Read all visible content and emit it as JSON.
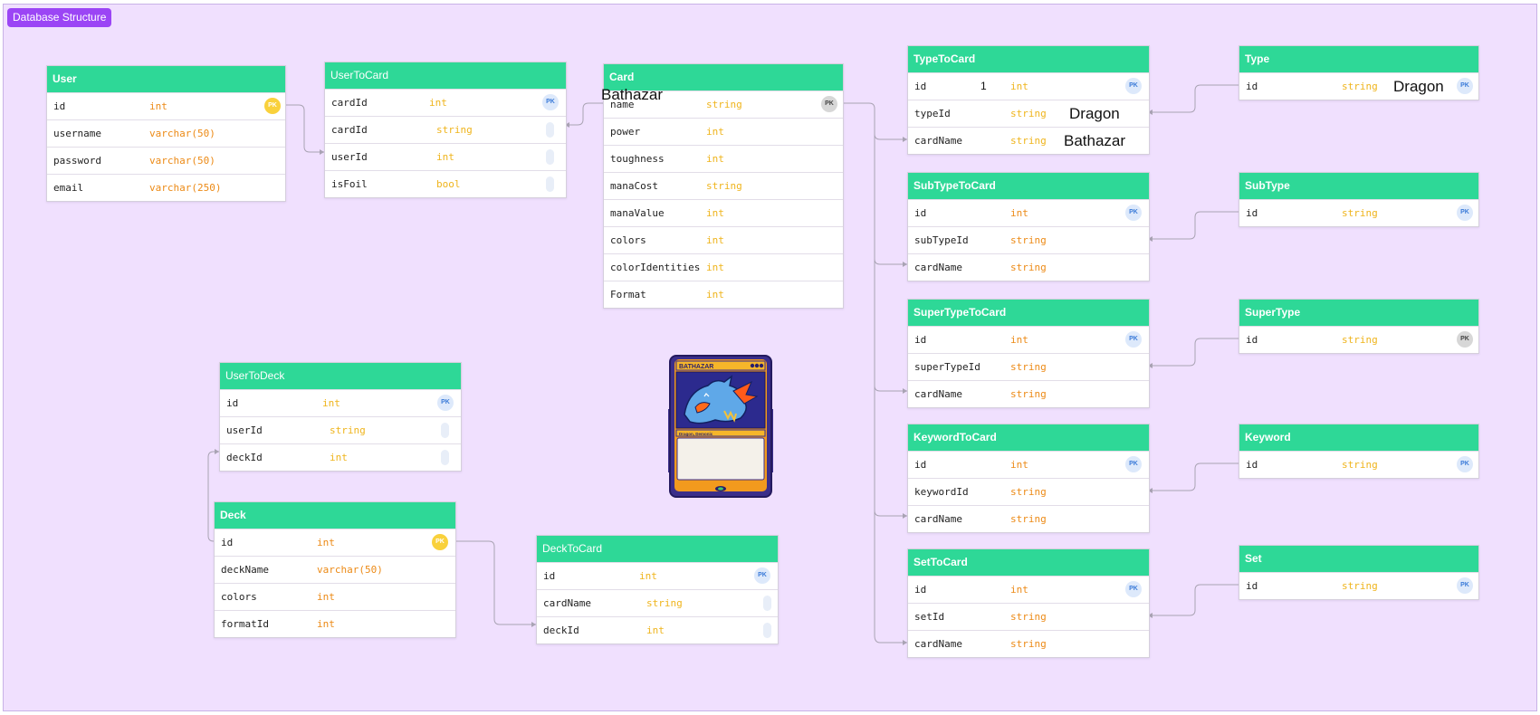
{
  "frame": {
    "label": "Database Structure"
  },
  "colors": {
    "background": "#f0e0fe",
    "header": "#2ed897",
    "frame_label": "#9b45f5",
    "type_orange": "#ec8a16",
    "type_yellow": "#efb41c",
    "pk_blue": "#dde9fb",
    "pk_gold": "#f9d13c"
  },
  "tables": {
    "user": {
      "title": "User",
      "rows": [
        {
          "field": "id",
          "type": "int",
          "badge": "PK"
        },
        {
          "field": "username",
          "type": "varchar(50)"
        },
        {
          "field": "password",
          "type": "varchar(50)"
        },
        {
          "field": "email",
          "type": "varchar(250)"
        }
      ]
    },
    "usertocard": {
      "title": "UserToCard",
      "rows": [
        {
          "field": "cardId",
          "type": "int",
          "badge": "PK"
        },
        {
          "field": "cardId",
          "type": "string"
        },
        {
          "field": "userId",
          "type": "int"
        },
        {
          "field": "isFoil",
          "type": "bool"
        }
      ]
    },
    "card": {
      "title": "Card",
      "overlay_text": "Bathazar",
      "rows": [
        {
          "field": "name",
          "type": "string",
          "badge": "PK"
        },
        {
          "field": "power",
          "type": "int"
        },
        {
          "field": "toughness",
          "type": "int"
        },
        {
          "field": "manaCost",
          "type": "string"
        },
        {
          "field": "manaValue",
          "type": "int"
        },
        {
          "field": "colors",
          "type": "int"
        },
        {
          "field": "colorIdentities",
          "type": "int"
        },
        {
          "field": "Format",
          "type": "int"
        }
      ]
    },
    "typetocard": {
      "title": "TypeToCard",
      "rows": [
        {
          "field": "id",
          "type": "int",
          "badge": "PK",
          "extra": "1"
        },
        {
          "field": "typeId",
          "type": "string",
          "extra": "Dragon"
        },
        {
          "field": "cardName",
          "type": "string",
          "extra": "Bathazar"
        }
      ]
    },
    "type": {
      "title": "Type",
      "rows": [
        {
          "field": "id",
          "type": "string",
          "badge": "PK",
          "extra": "Dragon"
        }
      ]
    },
    "subtypetocard": {
      "title": "SubTypeToCard",
      "rows": [
        {
          "field": "id",
          "type": "int",
          "badge": "PK"
        },
        {
          "field": "subTypeId",
          "type": "string"
        },
        {
          "field": "cardName",
          "type": "string"
        }
      ]
    },
    "subtype": {
      "title": "SubType",
      "rows": [
        {
          "field": "id",
          "type": "string",
          "badge": "PK"
        }
      ]
    },
    "supertypetocard": {
      "title": "SuperTypeToCard",
      "rows": [
        {
          "field": "id",
          "type": "int",
          "badge": "PK"
        },
        {
          "field": "superTypeId",
          "type": "string"
        },
        {
          "field": "cardName",
          "type": "string"
        }
      ]
    },
    "supertype": {
      "title": "SuperType",
      "rows": [
        {
          "field": "id",
          "type": "string",
          "badge": "PK"
        }
      ]
    },
    "keywordtocard": {
      "title": "KeywordToCard",
      "rows": [
        {
          "field": "id",
          "type": "int",
          "badge": "PK"
        },
        {
          "field": "keywordId",
          "type": "string"
        },
        {
          "field": "cardName",
          "type": "string"
        }
      ]
    },
    "keyword": {
      "title": "Keyword",
      "rows": [
        {
          "field": "id",
          "type": "string",
          "badge": "PK"
        }
      ]
    },
    "settocard": {
      "title": "SetToCard",
      "rows": [
        {
          "field": "id",
          "type": "int",
          "badge": "PK"
        },
        {
          "field": "setId",
          "type": "string"
        },
        {
          "field": "cardName",
          "type": "string"
        }
      ]
    },
    "set": {
      "title": "Set",
      "rows": [
        {
          "field": "id",
          "type": "string",
          "badge": "PK"
        }
      ]
    },
    "usertodeck": {
      "title": "UserToDeck",
      "rows": [
        {
          "field": "id",
          "type": "int",
          "badge": "PK"
        },
        {
          "field": "userId",
          "type": "string"
        },
        {
          "field": "deckId",
          "type": "int"
        }
      ]
    },
    "deck": {
      "title": "Deck",
      "rows": [
        {
          "field": "id",
          "type": "int",
          "badge": "PK"
        },
        {
          "field": "deckName",
          "type": "varchar(50)"
        },
        {
          "field": "colors",
          "type": "int"
        },
        {
          "field": "formatId",
          "type": "int"
        }
      ]
    },
    "decktocard": {
      "title": "DeckToCard",
      "rows": [
        {
          "field": "id",
          "type": "int",
          "badge": "PK"
        },
        {
          "field": "cardName",
          "type": "string"
        },
        {
          "field": "deckId",
          "type": "int"
        }
      ]
    }
  },
  "card_image": {
    "name": "BATHAZAR",
    "type_line": "Dragon, Demonic"
  }
}
